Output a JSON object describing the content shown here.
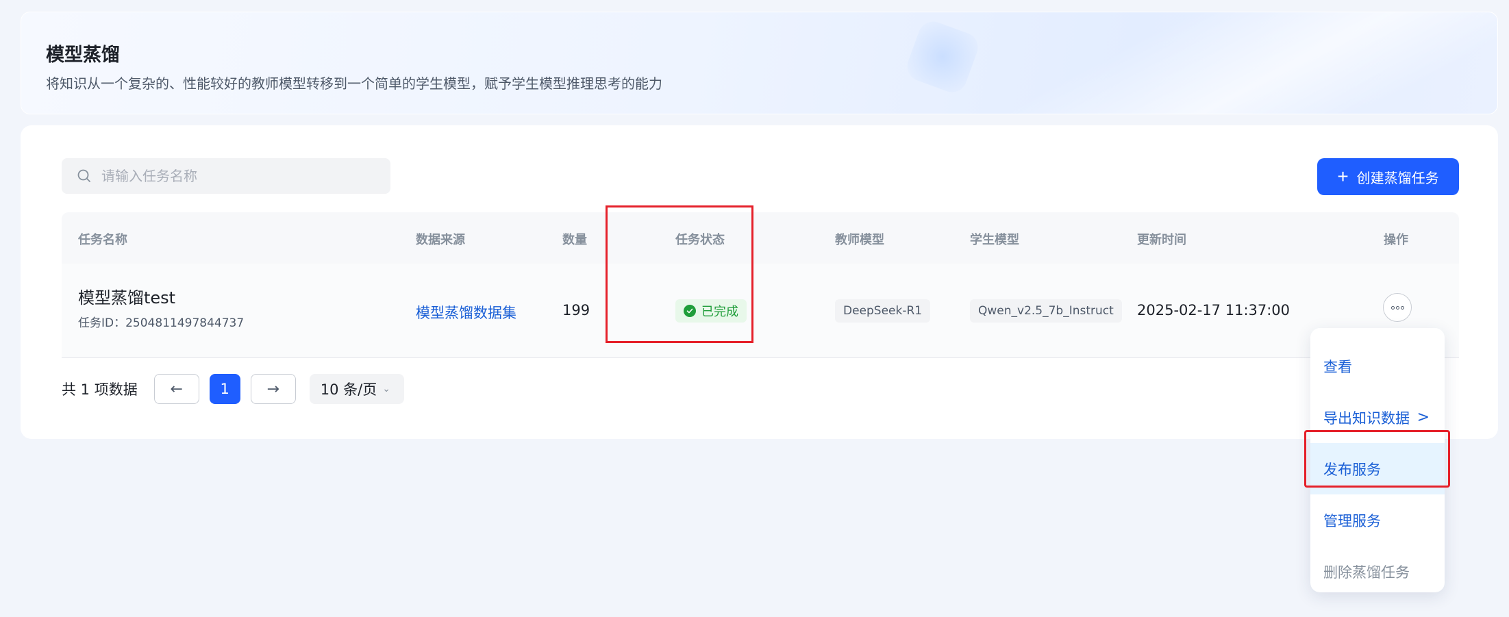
{
  "header": {
    "title": "模型蒸馏",
    "subtitle": "将知识从一个复杂的、性能较好的教师模型转移到一个简单的学生模型，赋予学生模型推理思考的能力"
  },
  "toolbar": {
    "search_placeholder": "请输入任务名称",
    "create_label": "创建蒸馏任务"
  },
  "table": {
    "columns": [
      "任务名称",
      "数据来源",
      "数量",
      "任务状态",
      "教师模型",
      "学生模型",
      "更新时间",
      "操作"
    ],
    "rows": [
      {
        "name": "模型蒸馏test",
        "task_id": "任务ID：2504811497844737",
        "source": "模型蒸馏数据集",
        "count": "199",
        "status": "已完成",
        "teacher": "DeepSeek-R1",
        "student": "Qwen_v2.5_7b_Instruct",
        "updated": "2025-02-17 11:37:00"
      }
    ]
  },
  "pagination": {
    "total": "共 1 项数据",
    "prev": "←",
    "current": "1",
    "next": "→",
    "page_size": "10 条/页"
  },
  "menu": {
    "items": [
      "查看",
      "导出知识数据",
      "发布服务",
      "管理服务",
      "删除蒸馏任务"
    ]
  },
  "colors": {
    "accent": "#1f5eff",
    "link": "#1a5fd6",
    "success": "#1f9d3a",
    "highlight": "#e5202a"
  }
}
